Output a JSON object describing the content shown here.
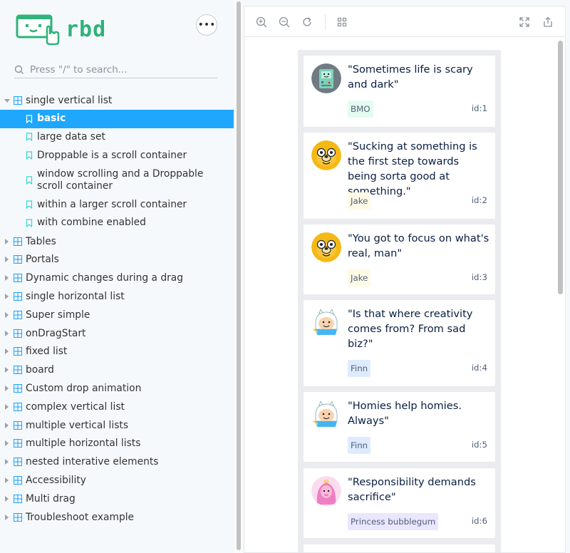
{
  "brand": {
    "name": "rbd",
    "color": "#2fb37a"
  },
  "sidebar": {
    "menu_icon": "ellipsis-icon",
    "search": {
      "placeholder": "Press \"/\" to search...",
      "value": ""
    },
    "groups": [
      {
        "label": "single vertical list",
        "expanded": true,
        "stories": [
          {
            "label": "basic",
            "selected": true
          },
          {
            "label": "large data set",
            "selected": false
          },
          {
            "label": "Droppable is a scroll container",
            "selected": false
          },
          {
            "label": "window scrolling and a Droppable scroll container",
            "selected": false
          },
          {
            "label": "within a larger scroll container",
            "selected": false
          },
          {
            "label": "with combine enabled",
            "selected": false
          }
        ]
      },
      {
        "label": "Tables",
        "expanded": false
      },
      {
        "label": "Portals",
        "expanded": false
      },
      {
        "label": "Dynamic changes during a drag",
        "expanded": false
      },
      {
        "label": "single horizontal list",
        "expanded": false
      },
      {
        "label": "Super simple",
        "expanded": false
      },
      {
        "label": "onDragStart",
        "expanded": false
      },
      {
        "label": "fixed list",
        "expanded": false
      },
      {
        "label": "board",
        "expanded": false
      },
      {
        "label": "Custom drop animation",
        "expanded": false
      },
      {
        "label": "complex vertical list",
        "expanded": false
      },
      {
        "label": "multiple vertical lists",
        "expanded": false
      },
      {
        "label": "multiple horizontal lists",
        "expanded": false
      },
      {
        "label": "nested interative elements",
        "expanded": false
      },
      {
        "label": "Accessibility",
        "expanded": false
      },
      {
        "label": "Multi drag",
        "expanded": false
      },
      {
        "label": "Troubleshoot example",
        "expanded": false
      }
    ],
    "selected_color": "#1ea7fd"
  },
  "toolbar": {
    "buttons": [
      "zoom-in-icon",
      "zoom-out-icon",
      "reset-zoom-icon",
      "grid-icon",
      "fullscreen-icon",
      "share-icon"
    ]
  },
  "quotes": [
    {
      "text": "\"Sometimes life is scary and dark\"",
      "author": "BMO",
      "id": "id:1",
      "avatar": "bmo-avatar",
      "author_bg": "#e3fcef"
    },
    {
      "text": "\"Sucking at something is the first step towards being sorta good at something.\"",
      "author": "Jake",
      "id": "id:2",
      "avatar": "jake-avatar",
      "author_bg": "#fffae6"
    },
    {
      "text": "\"You got to focus on what's real, man\"",
      "author": "Jake",
      "id": "id:3",
      "avatar": "jake-avatar",
      "author_bg": "#fffae6"
    },
    {
      "text": "\"Is that where creativity comes from? From sad biz?\"",
      "author": "Finn",
      "id": "id:4",
      "avatar": "finn-avatar",
      "author_bg": "#deebff"
    },
    {
      "text": "\"Homies help homies. Always\"",
      "author": "Finn",
      "id": "id:5",
      "avatar": "finn-avatar",
      "author_bg": "#deebff"
    },
    {
      "text": "\"Responsibility demands sacrifice\"",
      "author": "Princess bubblegum",
      "id": "id:6",
      "avatar": "princess-avatar",
      "author_bg": "#eae6ff"
    }
  ]
}
